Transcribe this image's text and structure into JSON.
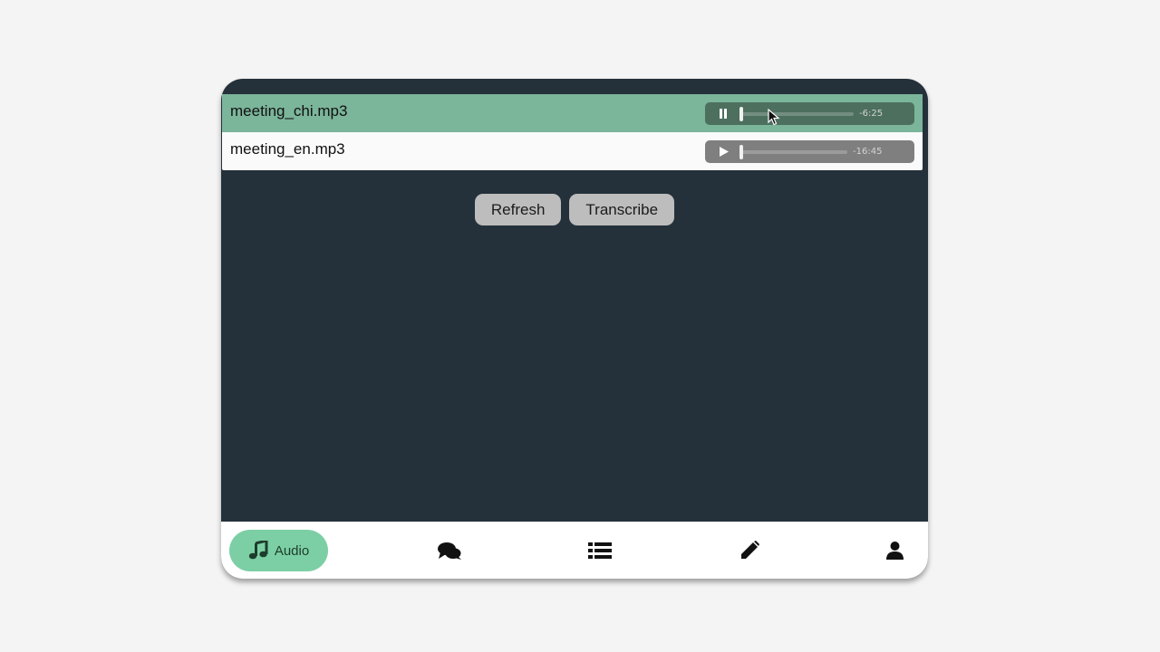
{
  "files": [
    {
      "name": "meeting_chi.mp3",
      "time": "-6:25",
      "state": "playing",
      "progress": 0
    },
    {
      "name": "meeting_en.mp3",
      "time": "-16:45",
      "state": "paused",
      "progress": 0
    }
  ],
  "actions": {
    "refresh_label": "Refresh",
    "transcribe_label": "Transcribe"
  },
  "nav": {
    "audio_label": "Audio",
    "items": [
      "music-icon",
      "chat-icon",
      "list-icon",
      "pencil-icon",
      "user-icon"
    ]
  },
  "colors": {
    "app_bg": "#25313a",
    "selected_row": "#7bb59a",
    "active_nav": "#7ccfa4",
    "button": "#bdbdbd"
  }
}
